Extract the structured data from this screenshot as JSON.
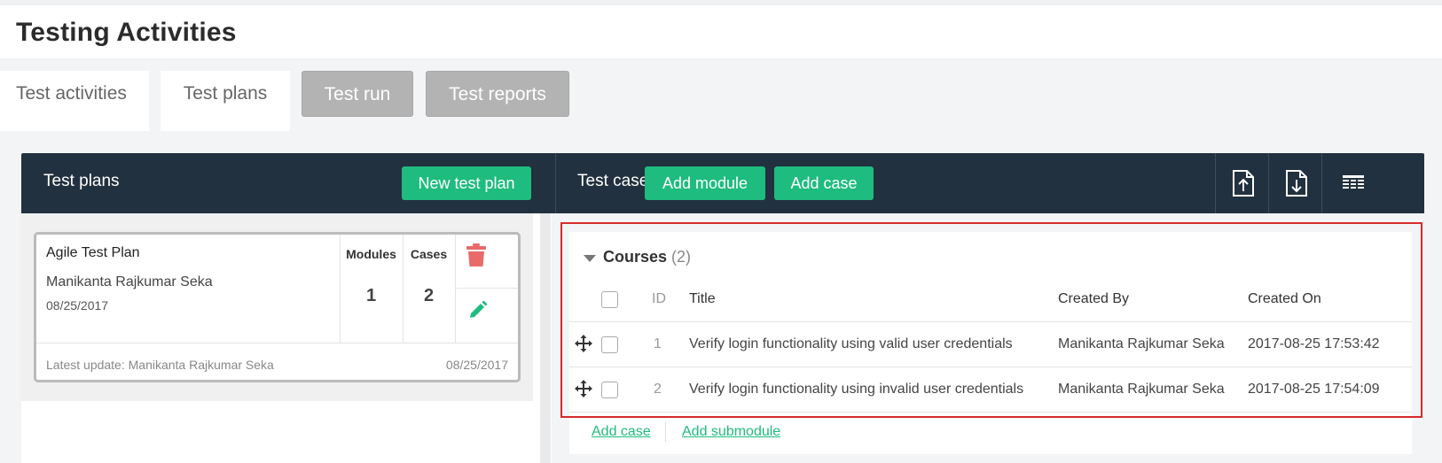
{
  "page": {
    "title": "Testing Activities"
  },
  "tabs": [
    {
      "label": "Test activities"
    },
    {
      "label": "Test plans"
    },
    {
      "label": "Test run"
    },
    {
      "label": "Test reports"
    }
  ],
  "toolbar": {
    "left_title": "Test plans",
    "new_plan_label": "New test plan",
    "right_title": "Test cases",
    "add_module_label": "Add module",
    "add_case_label": "Add case",
    "icons": [
      "upload-file-icon",
      "download-file-icon",
      "columns-icon"
    ]
  },
  "plan_card": {
    "name": "Agile Test Plan",
    "owner": "Manikanta Rajkumar Seka",
    "date": "08/25/2017",
    "modules_header": "Modules",
    "modules_value": "1",
    "cases_header": "Cases",
    "cases_value": "2",
    "latest_update": "Latest update: Manikanta Rajkumar Seka",
    "latest_update_date": "08/25/2017",
    "icons": [
      "trash-icon",
      "pencil-icon"
    ]
  },
  "module": {
    "name": "Courses",
    "count": "(2)"
  },
  "table": {
    "headers": {
      "id": "ID",
      "title": "Title",
      "created_by": "Created By",
      "created_on": "Created On"
    },
    "rows": [
      {
        "id": "1",
        "title": "Verify login functionality using valid user credentials",
        "created_by": "Manikanta Rajkumar Seka",
        "created_on": "2017-08-25 17:53:42"
      },
      {
        "id": "2",
        "title": "Verify login functionality using invalid user credentials",
        "created_by": "Manikanta Rajkumar Seka",
        "created_on": "2017-08-25 17:54:09"
      }
    ]
  },
  "footer_links": {
    "add_case": "Add case",
    "add_submodule": "Add submodule"
  },
  "colors": {
    "accent_green": "#1ebc7e",
    "navbar": "#22313f",
    "delete_red": "#e86a6a",
    "highlight_red": "#d62b2b"
  }
}
